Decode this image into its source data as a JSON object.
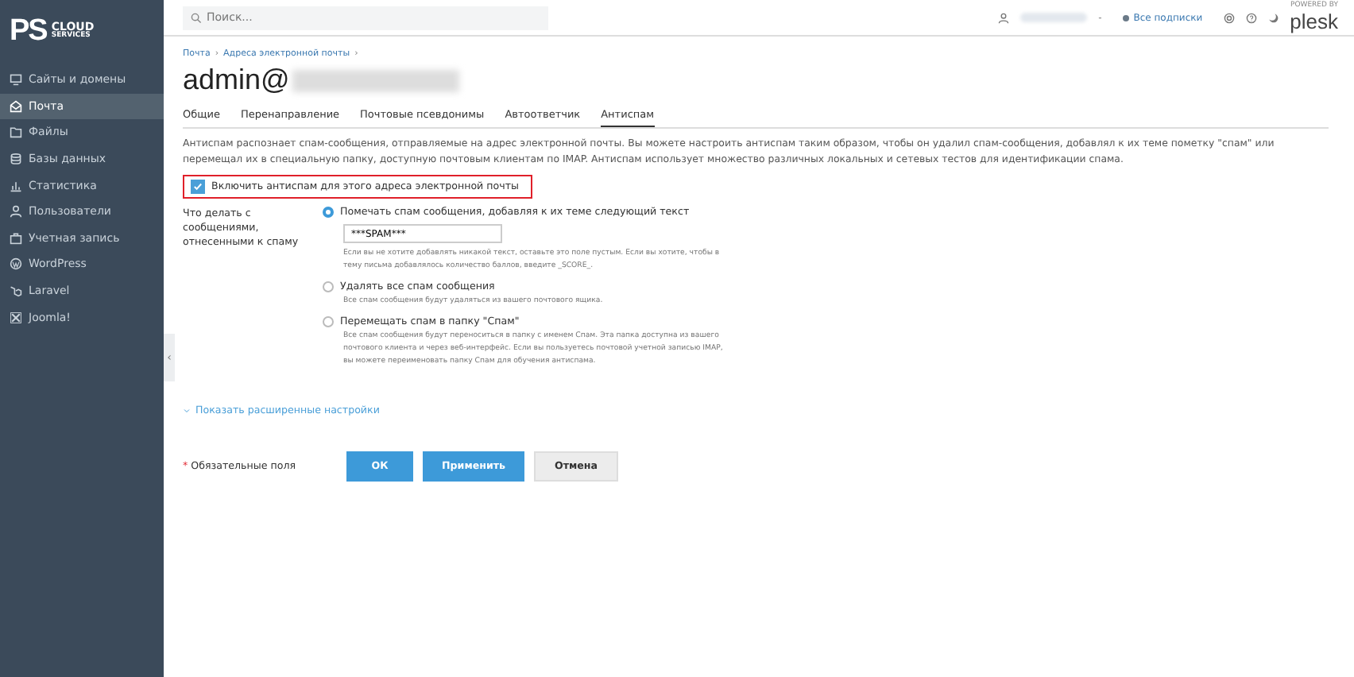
{
  "sidebar": {
    "logo": {
      "mark": "PS",
      "line1": "CLOUD",
      "line2": "SERVICES"
    },
    "items": [
      {
        "label": "Сайты и домены",
        "selected": false
      },
      {
        "label": "Почта",
        "selected": true
      },
      {
        "label": "Файлы",
        "selected": false
      },
      {
        "label": "Базы данных",
        "selected": false
      },
      {
        "label": "Статистика",
        "selected": false
      },
      {
        "label": "Пользователи",
        "selected": false
      },
      {
        "label": "Учетная запись",
        "selected": false
      },
      {
        "label": "WordPress",
        "selected": false
      },
      {
        "label": "Laravel",
        "selected": false
      },
      {
        "label": "Joomla!",
        "selected": false
      }
    ],
    "collapse": "‹"
  },
  "topbar": {
    "search": {
      "placeholder": "Поиск..."
    },
    "user_caret": "-",
    "subscriptions": "Все подписки",
    "brand": {
      "small": "POWERED BY",
      "name": "plesk"
    }
  },
  "breadcrumbs": [
    "Почта",
    "Адреса электронной почты"
  ],
  "breadcrumb_separator": "›",
  "title": "admin@",
  "tabs": [
    {
      "label": "Общие",
      "selected": false
    },
    {
      "label": "Перенаправление",
      "selected": false
    },
    {
      "label": "Почтовые псевдонимы",
      "selected": false
    },
    {
      "label": "Автоответчик",
      "selected": false
    },
    {
      "label": "Антиспам",
      "selected": true
    }
  ],
  "description": "Антиспам распознает спам-сообщения, отправляемые на адрес электронной почты. Вы можете настроить антиспам таким образом, чтобы он удалил спам-сообщения, добавлял к их теме пометку \"спам\" или перемещал их в специальную папку, доступную почтовым клиентам по IMAP. Антиспам использует множество различных локальных и сетевых тестов для идентификации спама.",
  "enable": {
    "label": "Включить антиспам для этого адреса электронной почты",
    "checked": true
  },
  "action": {
    "label": "Что делать с сообщениями, отнесенными к спаму",
    "options": [
      {
        "label": "Помечать спам сообщения, добавляя к их теме следующий текст",
        "selected": true,
        "value": "***SPAM***",
        "hint": "Если вы не хотите добавлять никакой текст, оставьте это поле пустым. Если вы хотите, чтобы в тему письма добавлялось количество баллов, введите _SCORE_."
      },
      {
        "label": "Удалять все спам сообщения",
        "selected": false,
        "hint": "Все спам сообщения будут удаляться из вашего почтового ящика."
      },
      {
        "label": "Перемещать спам в папку \"Спам\"",
        "selected": false,
        "hint": "Все спам сообщения будут переноситься в папку с именем Спам. Эта папка доступна из вашего почтового клиента и через веб-интерфейс. Если вы пользуетесь почтовой учетной записью IMAP, вы можете переименовать папку Спам для обучения антиспама."
      }
    ]
  },
  "advanced_link": "Показать расширенные настройки",
  "required_mark": "*",
  "required_note": "Обязательные поля",
  "buttons": [
    {
      "label": "ОК",
      "kind": "primary"
    },
    {
      "label": "Применить",
      "kind": "primary"
    },
    {
      "label": "Отмена",
      "kind": "secondary"
    }
  ]
}
